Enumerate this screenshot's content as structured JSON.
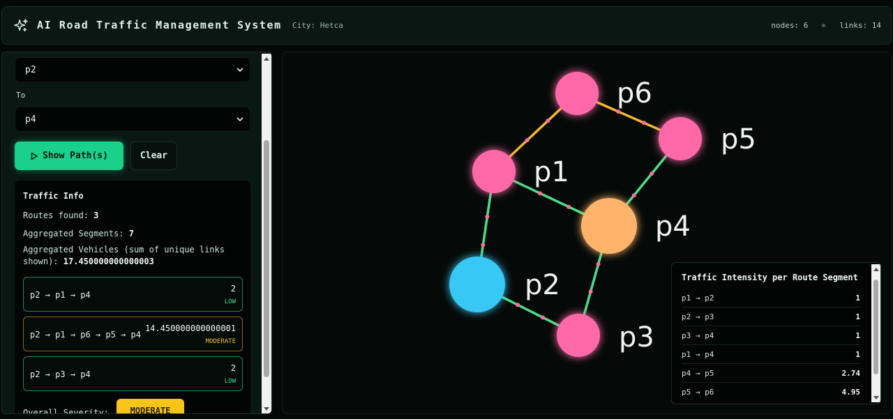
{
  "header": {
    "title": "AI Road Traffic Management System",
    "city": "City: Hetca",
    "nodes": "nodes: 6",
    "links": "links: 14",
    "logo_icon": "sparkles-icon"
  },
  "sidebar": {
    "from_value": "p2",
    "to_label": "To",
    "to_value": "p4",
    "show_button": "Show Path(s)",
    "clear_button": "Clear",
    "traffic_info": {
      "title": "Traffic Info",
      "routes_found_label": "Routes found: ",
      "routes_found": "3",
      "segments_label": "Aggregated Segments: ",
      "segments": "7",
      "vehicles_label": "Aggregated Vehicles (sum of unique links shown): ",
      "vehicles": "17.450000000000003",
      "routes": [
        {
          "path": "p2 → p1 → p4",
          "value": "2",
          "severity": "LOW",
          "level": "low"
        },
        {
          "path": "p2 → p1 → p6 → p5 → p4",
          "value": "14.450000000000001",
          "severity": "MODERATE",
          "level": "moderate"
        },
        {
          "path": "p2 → p3 → p4",
          "value": "2",
          "severity": "LOW",
          "level": "low"
        }
      ],
      "overall_label": "Overall Severity:",
      "overall_value": "MODERATE"
    }
  },
  "graph": {
    "nodes": [
      {
        "id": "p1",
        "color": "#ff69a8"
      },
      {
        "id": "p2",
        "color": "#38c8f5"
      },
      {
        "id": "p3",
        "color": "#ff69a8"
      },
      {
        "id": "p4",
        "color": "#ffb46a"
      },
      {
        "id": "p5",
        "color": "#ff69a8"
      },
      {
        "id": "p6",
        "color": "#ff69a8"
      }
    ],
    "edges": [
      {
        "from": "p1",
        "to": "p6",
        "color": "#f5b92c"
      },
      {
        "from": "p6",
        "to": "p5",
        "color": "#f5b92c"
      },
      {
        "from": "p1",
        "to": "p4",
        "color": "#4ade8c"
      },
      {
        "from": "p5",
        "to": "p4",
        "color": "#4ade8c"
      },
      {
        "from": "p1",
        "to": "p2",
        "color": "#4ade8c"
      },
      {
        "from": "p2",
        "to": "p3",
        "color": "#4ade8c"
      },
      {
        "from": "p3",
        "to": "p4",
        "color": "#4ade8c"
      }
    ]
  },
  "intensity": {
    "title": "Traffic Intensity per Route Segment",
    "rows": [
      {
        "segment": "p1 → p2",
        "value": "1"
      },
      {
        "segment": "p2 → p3",
        "value": "1"
      },
      {
        "segment": "p3 → p4",
        "value": "1"
      },
      {
        "segment": "p1 → p4",
        "value": "1"
      },
      {
        "segment": "p4 → p5",
        "value": "2.74"
      },
      {
        "segment": "p5 → p6",
        "value": "4.95"
      }
    ]
  },
  "colors": {
    "accent": "#19d189",
    "low": "#3ee08f",
    "moderate": "#f3c21c"
  }
}
